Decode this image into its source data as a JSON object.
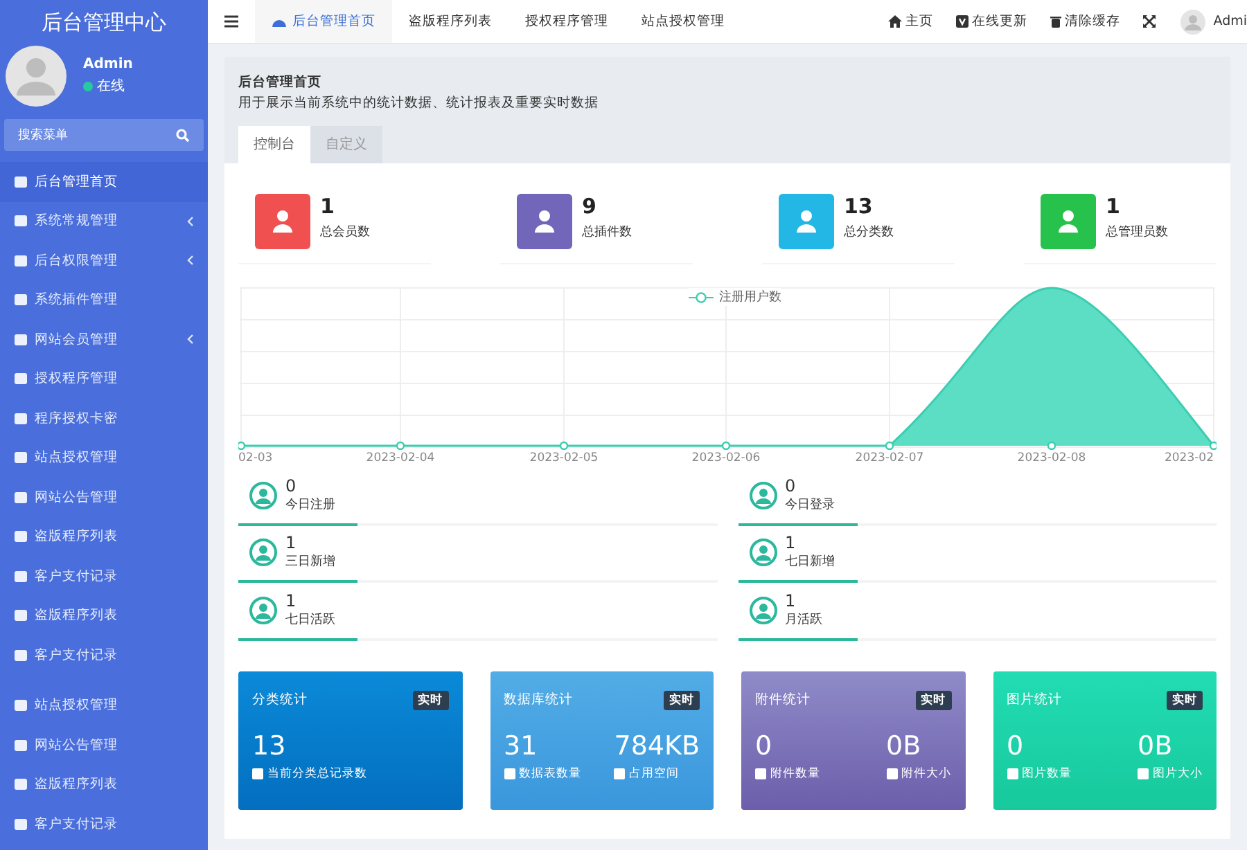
{
  "sidebar": {
    "title": "后台管理中心",
    "user": {
      "name": "Admin",
      "status": "在线",
      "online": true
    },
    "search": {
      "placeholder": "搜索菜单"
    },
    "sections": [
      {
        "items": [
          {
            "label": "后台管理首页",
            "selected": true,
            "has_submenu": false
          },
          {
            "label": "系统常规管理",
            "selected": false,
            "has_submenu": true
          },
          {
            "label": "后台权限管理",
            "selected": false,
            "has_submenu": true
          },
          {
            "label": "系统插件管理",
            "selected": false,
            "has_submenu": false
          },
          {
            "label": "网站会员管理",
            "selected": false,
            "has_submenu": true
          },
          {
            "label": "授权程序管理",
            "selected": false,
            "has_submenu": false
          },
          {
            "label": "程序授权卡密",
            "selected": false,
            "has_submenu": false
          },
          {
            "label": "站点授权管理",
            "selected": false,
            "has_submenu": false
          },
          {
            "label": "网站公告管理",
            "selected": false,
            "has_submenu": false
          },
          {
            "label": "盗版程序列表",
            "selected": false,
            "has_submenu": false
          },
          {
            "label": "客户支付记录",
            "selected": false,
            "has_submenu": false
          },
          {
            "label": "盗版程序列表",
            "selected": false,
            "has_submenu": false
          },
          {
            "label": "客户支付记录",
            "selected": false,
            "has_submenu": false
          }
        ]
      },
      {
        "items": [
          {
            "label": "站点授权管理",
            "selected": false,
            "has_submenu": false
          },
          {
            "label": "网站公告管理",
            "selected": false,
            "has_submenu": false
          },
          {
            "label": "盗版程序列表",
            "selected": false,
            "has_submenu": false
          },
          {
            "label": "客户支付记录",
            "selected": false,
            "has_submenu": false
          }
        ]
      }
    ]
  },
  "topbar": {
    "tabs": [
      {
        "label": "后台管理首页",
        "selected": true
      },
      {
        "label": "盗版程序列表",
        "selected": false
      },
      {
        "label": "授权程序管理",
        "selected": false
      },
      {
        "label": "站点授权管理",
        "selected": false
      }
    ],
    "actions": [
      {
        "kind": "home",
        "label": "主页"
      },
      {
        "kind": "update",
        "label": "在线更新"
      },
      {
        "kind": "trash",
        "label": "清除缓存"
      },
      {
        "kind": "fullscreen"
      }
    ],
    "user": "Admi"
  },
  "panel": {
    "title": "后台管理首页",
    "description": "用于展示当前系统中的统计数据、统计报表及重要实时数据",
    "tabs": [
      {
        "label": "控制台",
        "selected": true
      },
      {
        "label": "自定义",
        "selected": false
      }
    ]
  },
  "totals": [
    {
      "value": "1",
      "label": "总会员数",
      "color": "#f05050"
    },
    {
      "value": "9",
      "label": "总插件数",
      "color": "#7266ba"
    },
    {
      "value": "13",
      "label": "总分类数",
      "color": "#23b7e5"
    },
    {
      "value": "1",
      "label": "总管理员数",
      "color": "#27c24c"
    }
  ],
  "chart": {
    "legend": "注册用户数",
    "x_labels": [
      "02-03",
      "2023-02-04",
      "2023-02-05",
      "2023-02-06",
      "2023-02-07",
      "2023-02-08",
      "2023-02"
    ]
  },
  "activity": [
    {
      "value": "0",
      "label": "今日注册"
    },
    {
      "value": "0",
      "label": "今日登录"
    },
    {
      "value": "1",
      "label": "三日新增"
    },
    {
      "value": "1",
      "label": "七日新增"
    },
    {
      "value": "1",
      "label": "七日活跃"
    },
    {
      "value": "1",
      "label": "月活跃"
    }
  ],
  "cards": [
    {
      "title": "分类统计",
      "badge": "实时",
      "stats": [
        {
          "value": "13",
          "label": "当前分类总记录数"
        }
      ]
    },
    {
      "title": "数据库统计",
      "badge": "实时",
      "stats": [
        {
          "value": "31",
          "label": "数据表数量"
        },
        {
          "value": "784KB",
          "label": "占用空间"
        }
      ]
    },
    {
      "title": "附件统计",
      "badge": "实时",
      "stats": [
        {
          "value": "0",
          "label": "附件数量"
        },
        {
          "value": "0B",
          "label": "附件大小"
        }
      ]
    },
    {
      "title": "图片统计",
      "badge": "实时",
      "stats": [
        {
          "value": "0",
          "label": "图片数量"
        },
        {
          "value": "0B",
          "label": "图片大小"
        }
      ]
    }
  ]
}
